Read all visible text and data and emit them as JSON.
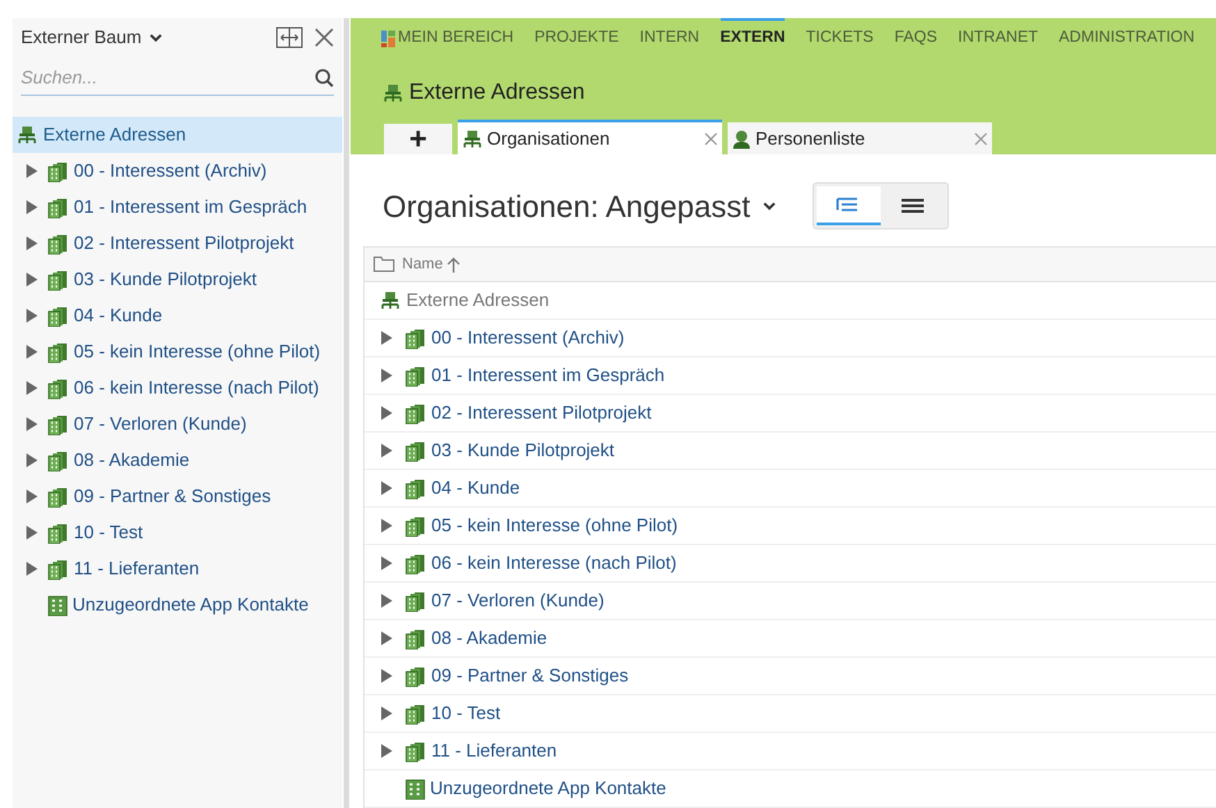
{
  "sidebar": {
    "title": "Externer Baum",
    "search": {
      "placeholder": "Suchen..."
    },
    "items": [
      {
        "label": "Externe Adressen",
        "kind": "root",
        "selected": true
      },
      {
        "label": "00 - Interessent (Archiv)",
        "kind": "group",
        "selected": false
      },
      {
        "label": "01 - Interessent im Gespräch",
        "kind": "group",
        "selected": false
      },
      {
        "label": "02 - Interessent Pilotprojekt",
        "kind": "group",
        "selected": false
      },
      {
        "label": "03 - Kunde Pilotprojekt",
        "kind": "group",
        "selected": false
      },
      {
        "label": "04 - Kunde",
        "kind": "group",
        "selected": false
      },
      {
        "label": "05 - kein Interesse (ohne Pilot)",
        "kind": "group",
        "selected": false
      },
      {
        "label": "06 - kein Interesse (nach Pilot)",
        "kind": "group",
        "selected": false
      },
      {
        "label": "07 - Verloren (Kunde)",
        "kind": "group",
        "selected": false
      },
      {
        "label": "08 - Akademie",
        "kind": "group",
        "selected": false
      },
      {
        "label": "09 - Partner & Sonstiges",
        "kind": "group",
        "selected": false
      },
      {
        "label": "10 - Test",
        "kind": "group",
        "selected": false
      },
      {
        "label": "11 - Lieferanten",
        "kind": "group",
        "selected": false
      },
      {
        "label": "Unzugeordnete App Kontakte",
        "kind": "single",
        "selected": false
      }
    ]
  },
  "nav": [
    {
      "label": "MEIN BEREICH",
      "selected": false
    },
    {
      "label": "PROJEKTE",
      "selected": false
    },
    {
      "label": "INTERN",
      "selected": false
    },
    {
      "label": "EXTERN",
      "selected": true
    },
    {
      "label": "TICKETS",
      "selected": false
    },
    {
      "label": "FAQS",
      "selected": false
    },
    {
      "label": "INTRANET",
      "selected": false
    },
    {
      "label": "ADMINISTRATION",
      "selected": false
    }
  ],
  "page_title": "Externe Adressen",
  "add_tab": "+",
  "tabs": [
    {
      "label": "Organisationen",
      "kind": "org",
      "selected": true
    },
    {
      "label": "Personenliste",
      "kind": "person",
      "selected": false
    }
  ],
  "view_title": "Organisationen: Angepasst",
  "view_modes": [
    {
      "kind": "tree",
      "selected": true
    },
    {
      "kind": "list",
      "selected": false
    }
  ],
  "table": {
    "column": "Name",
    "rows": [
      {
        "label": "Externe Adressen",
        "kind": "root"
      },
      {
        "label": "00 - Interessent (Archiv)",
        "kind": "group"
      },
      {
        "label": "01 - Interessent im Gespräch",
        "kind": "group"
      },
      {
        "label": "02 - Interessent Pilotprojekt",
        "kind": "group"
      },
      {
        "label": "03 - Kunde Pilotprojekt",
        "kind": "group"
      },
      {
        "label": "04 - Kunde",
        "kind": "group"
      },
      {
        "label": "05 - kein Interesse (ohne Pilot)",
        "kind": "group"
      },
      {
        "label": "06 - kein Interesse (nach Pilot)",
        "kind": "group"
      },
      {
        "label": "07 - Verloren (Kunde)",
        "kind": "group"
      },
      {
        "label": "08 - Akademie",
        "kind": "group"
      },
      {
        "label": "09 - Partner & Sonstiges",
        "kind": "group"
      },
      {
        "label": "10 - Test",
        "kind": "group"
      },
      {
        "label": "11 - Lieferanten",
        "kind": "group"
      },
      {
        "label": "Unzugeordnete App Kontakte",
        "kind": "single"
      }
    ]
  }
}
